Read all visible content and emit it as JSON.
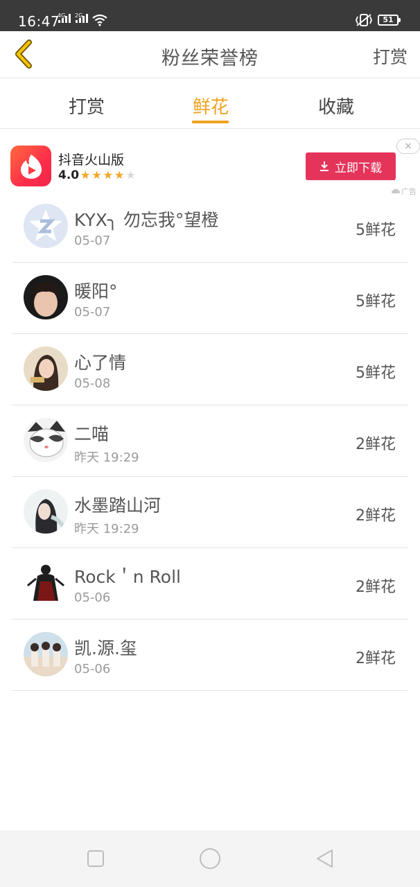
{
  "status_bar": {
    "time": "16:47",
    "signal_1_label": "4G",
    "signal_2_label": "2G",
    "battery": "51"
  },
  "header": {
    "title": "粉丝荣誉榜",
    "right_link": "打赏"
  },
  "tabs": [
    {
      "label": "打赏",
      "active": false
    },
    {
      "label": "鲜花",
      "active": true
    },
    {
      "label": "收藏",
      "active": false
    }
  ],
  "ad": {
    "app_name": "抖音火山版",
    "rating": "4.0",
    "stars_filled": 4,
    "stars_total": 5,
    "button_label": "立即下载",
    "close_symbol": "×",
    "tag": "广告"
  },
  "fans": [
    {
      "name": "KYX╮ 勿忘我°望橙",
      "date": "05-07",
      "count": "5鲜花"
    },
    {
      "name": "暖阳°",
      "date": "05-07",
      "count": "5鲜花"
    },
    {
      "name": "心了情",
      "date": "05-08",
      "count": "5鲜花"
    },
    {
      "name": "二喵",
      "date": "昨天 19:29",
      "count": "2鲜花"
    },
    {
      "name": "水墨踏山河",
      "date": "昨天 19:29",
      "count": "2鲜花"
    },
    {
      "name": "Rock＇n Roll",
      "date": "05-06",
      "count": "2鲜花"
    },
    {
      "name": "凯.源.玺",
      "date": "05-06",
      "count": "2鲜花"
    }
  ],
  "colors": {
    "accent": "#f0a21f",
    "ad_button": "#e5345a",
    "status_bar": "#3a3a3a"
  },
  "icons": {
    "back": "chevron-left-icon",
    "download": "download-icon",
    "nav_recent": "square-icon",
    "nav_home": "circle-icon",
    "nav_back": "triangle-back-icon"
  }
}
